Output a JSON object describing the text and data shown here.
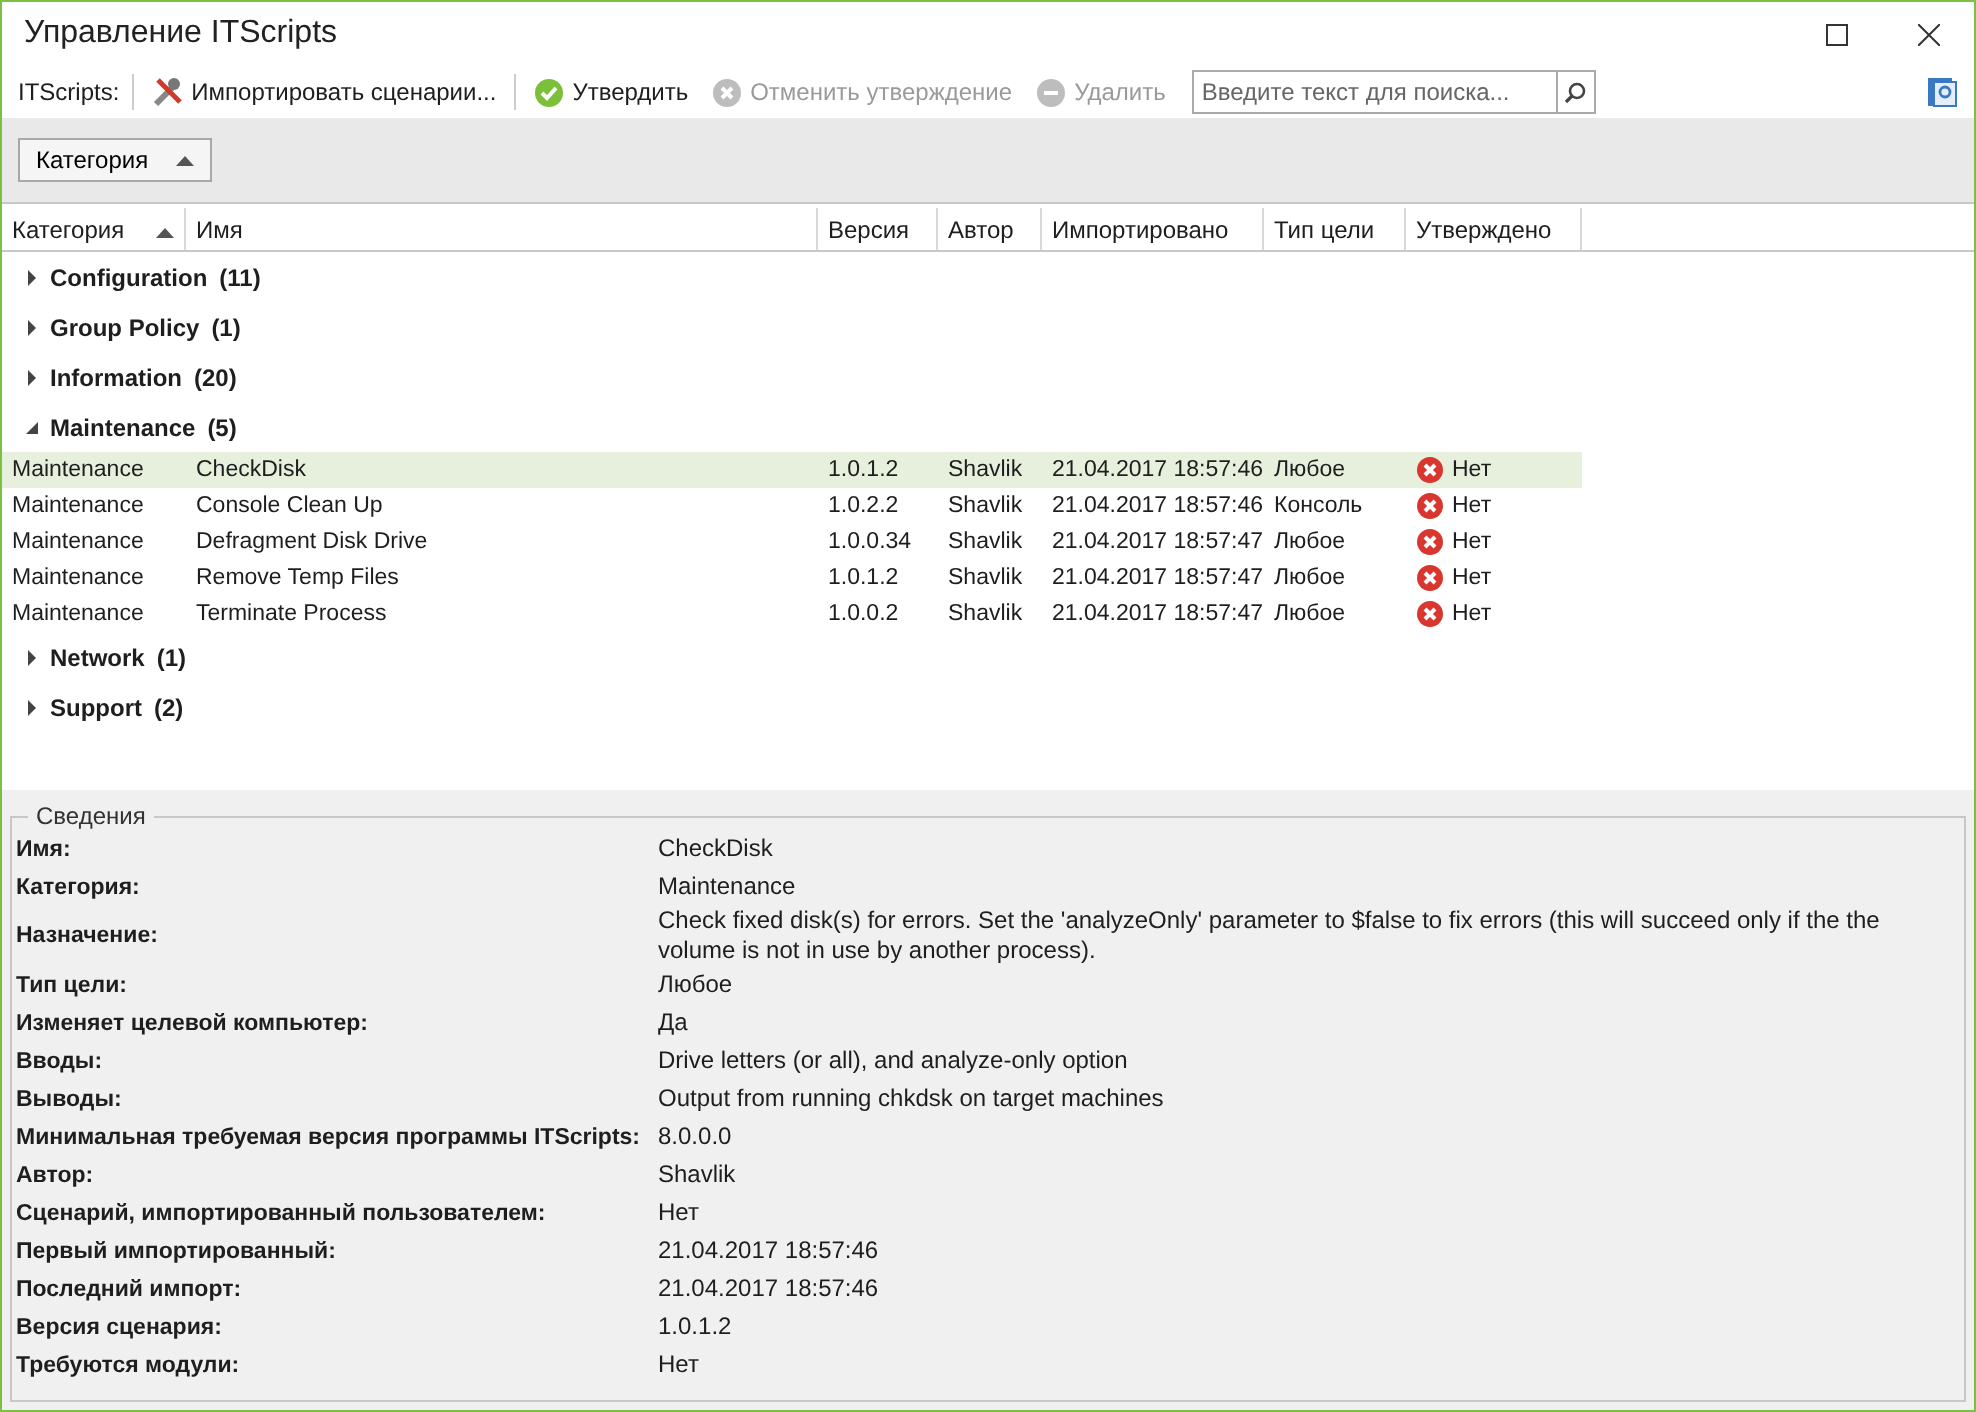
{
  "window": {
    "title": "Управление ITScripts"
  },
  "toolbar": {
    "label": "ITScripts:",
    "buttons": [
      {
        "kind": "import",
        "label": "Импортировать сценарии...",
        "disabled": false
      },
      {
        "kind": "approve",
        "label": "Утвердить",
        "disabled": false
      },
      {
        "kind": "unapprove",
        "label": "Отменить утверждение",
        "disabled": true
      },
      {
        "kind": "delete",
        "label": "Удалить",
        "disabled": true
      }
    ],
    "search": {
      "placeholder": "Введите текст для поиска..."
    }
  },
  "group_by": {
    "label": "Категория"
  },
  "table": {
    "columns": [
      {
        "label": "Категория",
        "sorted": true
      },
      {
        "label": "Имя",
        "sorted": false
      },
      {
        "label": "Версия",
        "sorted": false
      },
      {
        "label": "Автор",
        "sorted": false
      },
      {
        "label": "Импортировано",
        "sorted": false
      },
      {
        "label": "Тип цели",
        "sorted": false
      },
      {
        "label": "Утверждено",
        "sorted": false
      }
    ],
    "groups": [
      {
        "name": "Configuration",
        "count": "(11)",
        "expanded": false
      },
      {
        "name": "Group Policy",
        "count": "(1)",
        "expanded": false
      },
      {
        "name": "Information",
        "count": "(20)",
        "expanded": false
      },
      {
        "name": "Maintenance",
        "count": "(5)",
        "expanded": true,
        "rows": [
          {
            "category": "Maintenance",
            "name": "CheckDisk",
            "version": "1.0.1.2",
            "author": "Shavlik",
            "imported": "21.04.2017 18:57:46",
            "target": "Любое",
            "approved": false,
            "approved_text": "Нет",
            "selected": true
          },
          {
            "category": "Maintenance",
            "name": "Console Clean Up",
            "version": "1.0.2.2",
            "author": "Shavlik",
            "imported": "21.04.2017 18:57:46",
            "target": "Консоль",
            "approved": false,
            "approved_text": "Нет",
            "selected": false
          },
          {
            "category": "Maintenance",
            "name": "Defragment Disk Drive",
            "version": "1.0.0.34",
            "author": "Shavlik",
            "imported": "21.04.2017 18:57:47",
            "target": "Любое",
            "approved": false,
            "approved_text": "Нет",
            "selected": false
          },
          {
            "category": "Maintenance",
            "name": "Remove Temp Files",
            "version": "1.0.1.2",
            "author": "Shavlik",
            "imported": "21.04.2017 18:57:47",
            "target": "Любое",
            "approved": false,
            "approved_text": "Нет",
            "selected": false
          },
          {
            "category": "Maintenance",
            "name": "Terminate Process",
            "version": "1.0.0.2",
            "author": "Shavlik",
            "imported": "21.04.2017 18:57:47",
            "target": "Любое",
            "approved": false,
            "approved_text": "Нет",
            "selected": false
          }
        ]
      },
      {
        "name": "Network",
        "count": "(1)",
        "expanded": false
      },
      {
        "name": "Support",
        "count": "(2)",
        "expanded": false
      }
    ]
  },
  "details": {
    "title": "Сведения",
    "fields": [
      {
        "label": "Имя:",
        "value": "CheckDisk"
      },
      {
        "label": "Категория:",
        "value": "Maintenance"
      },
      {
        "label": "Назначение:",
        "value": "Check fixed disk(s) for errors.  Set the 'analyzeOnly' parameter to $false to fix errors (this will succeed only if the the volume is not in use by another process)."
      },
      {
        "label": "Тип цели:",
        "value": "Любое"
      },
      {
        "label": "Изменяет целевой компьютер:",
        "value": "Да"
      },
      {
        "label": "Вводы:",
        "value": "Drive letters (or all), and analyze-only option"
      },
      {
        "label": "Выводы:",
        "value": "Output from running chkdsk on target machines"
      },
      {
        "label": "Минимальная требуемая версия программы ITScripts:",
        "value": "8.0.0.0"
      },
      {
        "label": "Автор:",
        "value": "Shavlik"
      },
      {
        "label": "Сценарий, импортированный пользователем:",
        "value": "Нет"
      },
      {
        "label": "Первый импортированный:",
        "value": "21.04.2017 18:57:46"
      },
      {
        "label": "Последний импорт:",
        "value": "21.04.2017 18:57:46"
      },
      {
        "label": "Версия сценария:",
        "value": "1.0.1.2"
      },
      {
        "label": "Требуются модули:",
        "value": "Нет"
      }
    ]
  }
}
